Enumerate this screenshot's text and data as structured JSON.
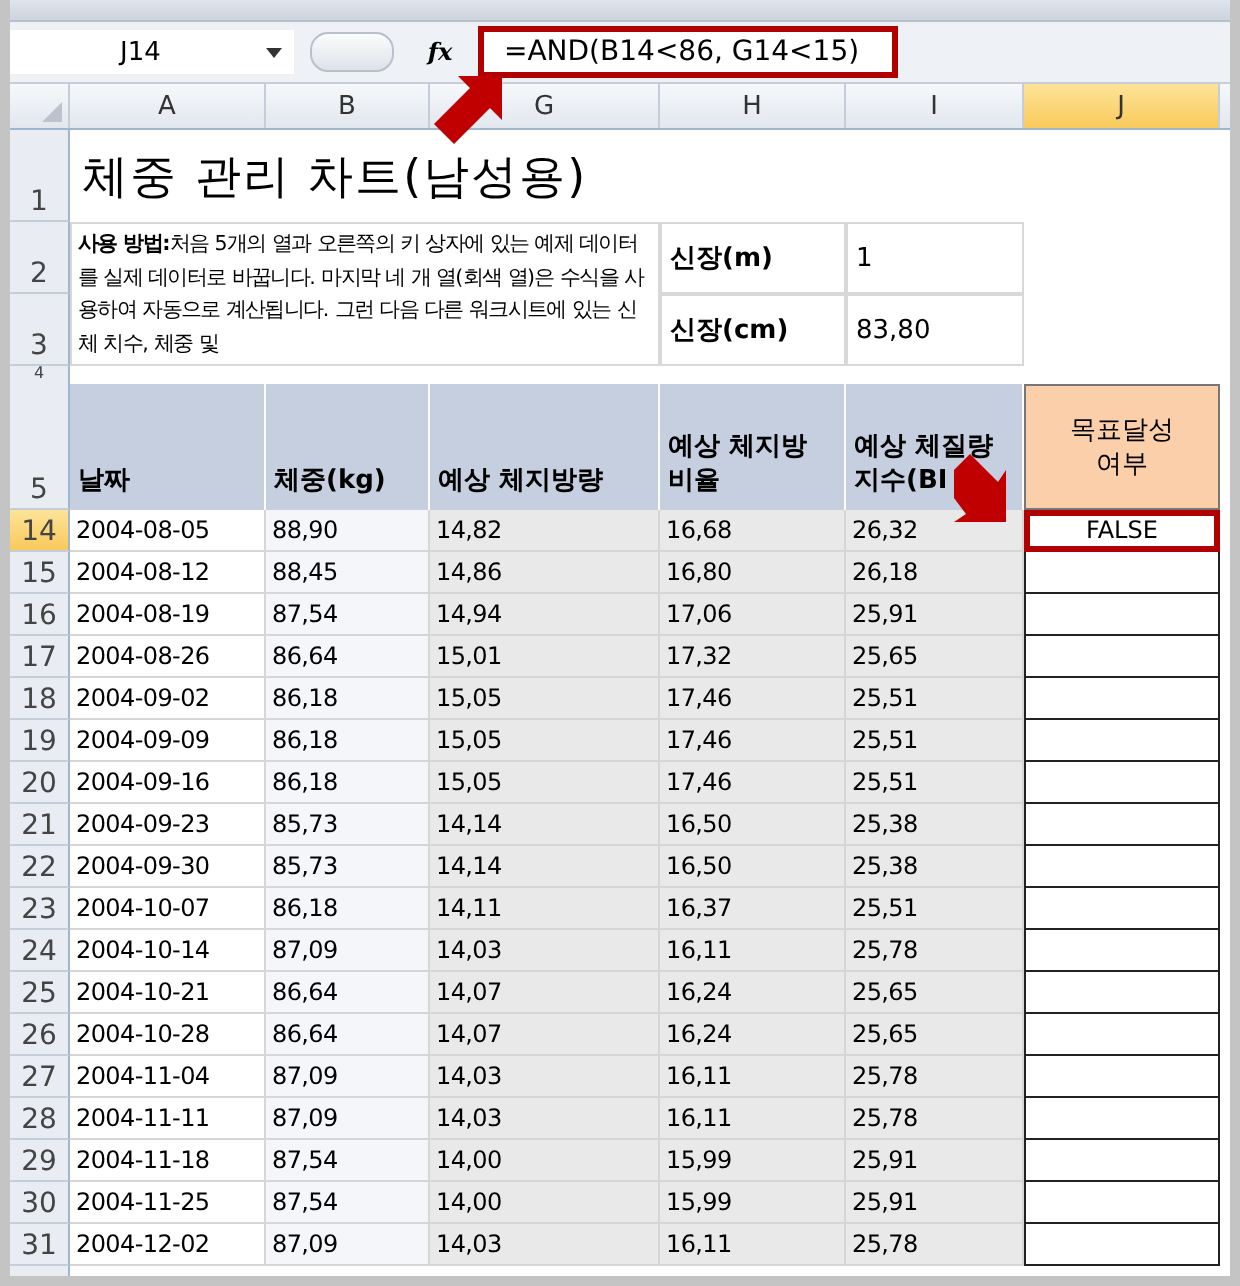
{
  "formula_bar": {
    "name_box": "J14",
    "function_button": "fx",
    "formula": "=AND(B14<86, G14<15)",
    "highlighted": true
  },
  "column_headers": [
    {
      "label": "A",
      "selected": false
    },
    {
      "label": "B",
      "selected": false
    },
    {
      "label": "G",
      "selected": false
    },
    {
      "label": "H",
      "selected": false
    },
    {
      "label": "I",
      "selected": false
    },
    {
      "label": "J",
      "selected": true
    }
  ],
  "title": {
    "row": "1",
    "text": "체중 관리 차트(남성용)"
  },
  "instructions": {
    "rows": [
      "2",
      "3"
    ],
    "text": "**사용 방법:**처음 5개의 열과 오른쪽의 키 상자에 있는 예제 데이터를 실제 데이터로 바꿉니다. 마지막 네 개 열(회색 열)은 수식을 사용하여 자동으로 계산됩니다. 그런 다음 다른 워크시트에 있는 신체 치수, 체중 및"
  },
  "height_box": [
    {
      "label": "신장(m)",
      "value": "1"
    },
    {
      "label": "신장(cm)",
      "value": "83,80"
    }
  ],
  "spacer_row": "4",
  "table_header": {
    "row": "5",
    "columns": [
      "날짜",
      "체중(kg)",
      "예상 체지방량",
      "예상 체지방 비율",
      "예상 체질량 지수(BI",
      "목표달성 여부"
    ]
  },
  "rows": [
    {
      "row": "14",
      "cells": [
        "2004-08-05",
        "88,90",
        "14,82",
        "16,68",
        "26,32"
      ],
      "goal": "FALSE",
      "selected": true
    },
    {
      "row": "15",
      "cells": [
        "2004-08-12",
        "88,45",
        "14,86",
        "16,80",
        "26,18"
      ],
      "selected": false
    },
    {
      "row": "16",
      "cells": [
        "2004-08-19",
        "87,54",
        "14,94",
        "17,06",
        "25,91"
      ],
      "selected": false
    },
    {
      "row": "17",
      "cells": [
        "2004-08-26",
        "86,64",
        "15,01",
        "17,32",
        "25,65"
      ],
      "selected": false
    },
    {
      "row": "18",
      "cells": [
        "2004-09-02",
        "86,18",
        "15,05",
        "17,46",
        "25,51"
      ],
      "selected": false
    },
    {
      "row": "19",
      "cells": [
        "2004-09-09",
        "86,18",
        "15,05",
        "17,46",
        "25,51"
      ],
      "selected": false
    },
    {
      "row": "20",
      "cells": [
        "2004-09-16",
        "86,18",
        "15,05",
        "17,46",
        "25,51"
      ],
      "selected": false
    },
    {
      "row": "21",
      "cells": [
        "2004-09-23",
        "85,73",
        "14,14",
        "16,50",
        "25,38"
      ],
      "selected": false
    },
    {
      "row": "22",
      "cells": [
        "2004-09-30",
        "85,73",
        "14,14",
        "16,50",
        "25,38"
      ],
      "selected": false
    },
    {
      "row": "23",
      "cells": [
        "2004-10-07",
        "86,18",
        "14,11",
        "16,37",
        "25,51"
      ],
      "selected": false
    },
    {
      "row": "24",
      "cells": [
        "2004-10-14",
        "87,09",
        "14,03",
        "16,11",
        "25,78"
      ],
      "selected": false
    },
    {
      "row": "25",
      "cells": [
        "2004-10-21",
        "86,64",
        "14,07",
        "16,24",
        "25,65"
      ],
      "selected": false
    },
    {
      "row": "26",
      "cells": [
        "2004-10-28",
        "86,64",
        "14,07",
        "16,24",
        "25,65"
      ],
      "selected": false
    },
    {
      "row": "27",
      "cells": [
        "2004-11-04",
        "87,09",
        "14,03",
        "16,11",
        "25,78"
      ],
      "selected": false
    },
    {
      "row": "28",
      "cells": [
        "2004-11-11",
        "87,09",
        "14,03",
        "16,11",
        "25,78"
      ],
      "selected": false
    },
    {
      "row": "29",
      "cells": [
        "2004-11-18",
        "87,54",
        "14,00",
        "15,99",
        "25,91"
      ],
      "selected": false
    },
    {
      "row": "30",
      "cells": [
        "2004-11-25",
        "87,54",
        "14,00",
        "15,99",
        "25,91"
      ],
      "selected": false
    },
    {
      "row": "31",
      "cells": [
        "2004-12-02",
        "87,09",
        "14,03",
        "16,11",
        "25,78"
      ],
      "selected": false
    }
  ]
}
